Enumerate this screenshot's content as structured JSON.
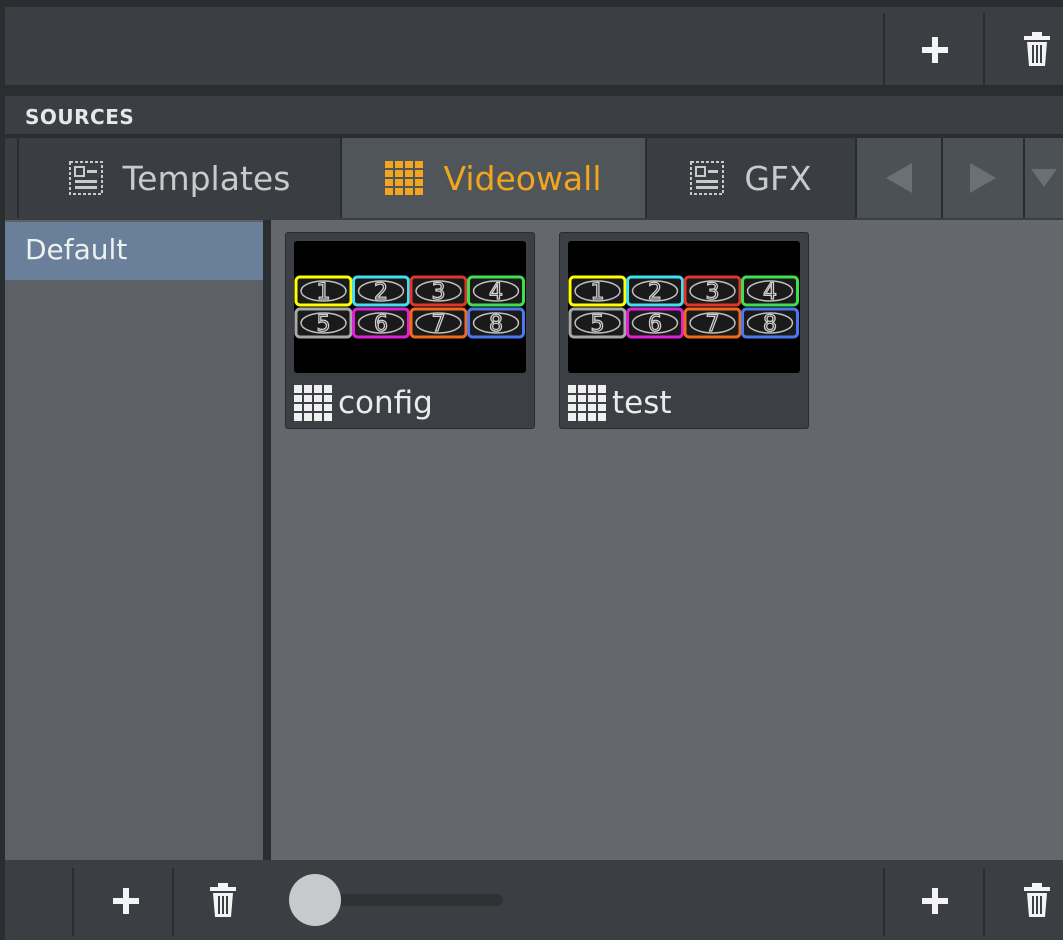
{
  "header": {
    "title": "SOURCES"
  },
  "tabs": [
    {
      "label": "Templates",
      "icon": "template-icon",
      "active": false
    },
    {
      "label": "Videowall",
      "icon": "videowall-grid-icon",
      "active": true
    },
    {
      "label": "GFX",
      "icon": "template-icon",
      "active": false
    }
  ],
  "sidebar": {
    "items": [
      {
        "label": "Default",
        "selected": true
      }
    ]
  },
  "cards": [
    {
      "label": "config",
      "icon": "videowall-grid-icon"
    },
    {
      "label": "test",
      "icon": "videowall-grid-icon"
    }
  ],
  "thumbnail_tiles": [
    {
      "number": "1",
      "color": "#ffff00"
    },
    {
      "number": "2",
      "color": "#3fe0f0"
    },
    {
      "number": "3",
      "color": "#e0342c"
    },
    {
      "number": "4",
      "color": "#3fe04c"
    },
    {
      "number": "5",
      "color": "#a8a8a8"
    },
    {
      "number": "6",
      "color": "#e020d8"
    },
    {
      "number": "7",
      "color": "#f06a1c"
    },
    {
      "number": "8",
      "color": "#4a78f0"
    }
  ],
  "colors": {
    "accent": "#f2a51f",
    "selection": "#6a7f99"
  },
  "zoom_slider": {
    "value": 0
  }
}
